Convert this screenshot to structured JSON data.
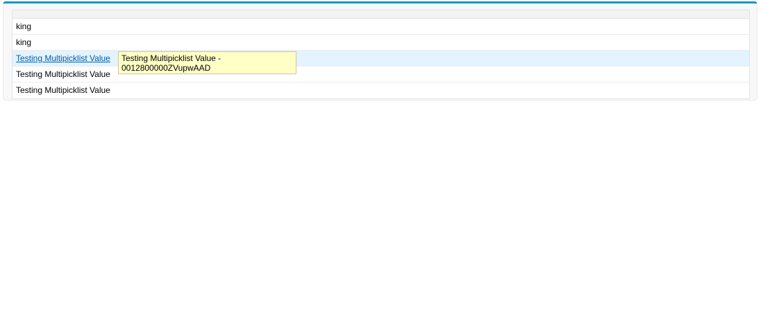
{
  "rows": [
    {
      "text": "king"
    },
    {
      "text": "king"
    },
    {
      "text": "Testing Multipicklist Value"
    },
    {
      "text": "Testing Multipicklist Value"
    },
    {
      "text": "Testing Multipicklist Value"
    }
  ],
  "tooltip": {
    "line1": "Testing Multipicklist Value -",
    "line2": "0012800000ZVupwAAD"
  },
  "colors": {
    "accent_border": "#1797c0",
    "highlight_row": "#e3f3ff",
    "link": "#015ba7",
    "tooltip_bg": "#ffffc6"
  }
}
